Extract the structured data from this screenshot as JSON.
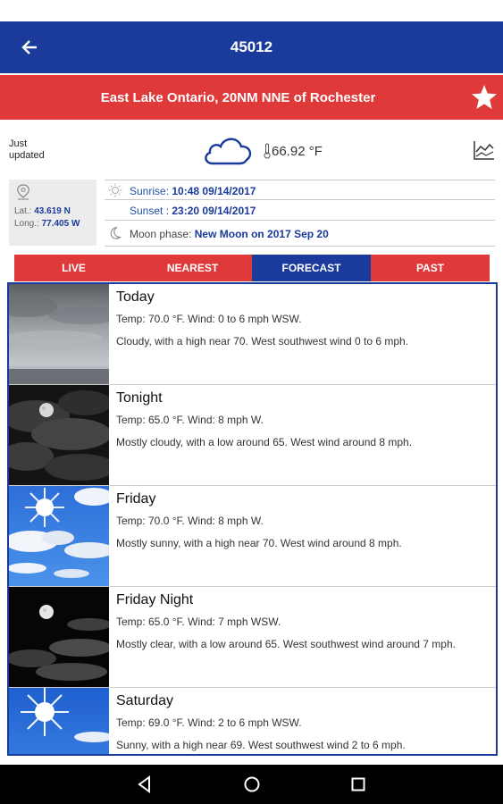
{
  "app_bar": {
    "title": "45012"
  },
  "location": {
    "title": "East Lake Ontario, 20NM NNE of Rochester"
  },
  "conditions": {
    "updated_line1": "Just",
    "updated_line2": "updated",
    "temperature": "66.92 °F"
  },
  "coords": {
    "lat_label": "Lat.:",
    "lat_value": "43.619 N",
    "long_label": "Long.:",
    "long_value": "77.405 W"
  },
  "sun": {
    "sunrise_label": "Sunrise:",
    "sunrise_value": "10:48 09/14/2017",
    "sunset_label": "Sunset :",
    "sunset_value": "23:20 09/14/2017",
    "moon_label": "Moon phase:",
    "moon_value": "New Moon on 2017 Sep 20"
  },
  "tabs": [
    {
      "label": "LIVE"
    },
    {
      "label": "NEAREST"
    },
    {
      "label": "FORECAST"
    },
    {
      "label": "PAST"
    }
  ],
  "active_tab": "FORECAST",
  "forecast": [
    {
      "name": "Today",
      "temp": "Temp: 70.0 °F. Wind: 0 to 6 mph WSW.",
      "desc": "Cloudy, with a high near 70. West southwest wind 0 to 6 mph.",
      "icon": "overcast-photo"
    },
    {
      "name": "Tonight",
      "temp": "Temp: 65.0 °F. Wind: 8 mph W.",
      "desc": "Mostly cloudy, with a low around 65. West wind around 8 mph.",
      "icon": "cloudy-night-photo"
    },
    {
      "name": "Friday",
      "temp": "Temp: 70.0 °F. Wind: 8 mph W.",
      "desc": "Mostly sunny, with a high near 70. West wind around 8 mph.",
      "icon": "mostly-sunny-photo"
    },
    {
      "name": "Friday Night",
      "temp": "Temp: 65.0 °F. Wind: 7 mph WSW.",
      "desc": "Mostly clear, with a low around 65. West southwest wind around 7 mph.",
      "icon": "clear-night-photo"
    },
    {
      "name": "Saturday",
      "temp": "Temp: 69.0 °F. Wind: 2 to 6 mph WSW.",
      "desc": "Sunny, with a high near 69. West southwest wind 2 to 6 mph.",
      "icon": "sunny-photo"
    }
  ],
  "colors": {
    "primary": "#1a3a9c",
    "accent": "#e0393a"
  }
}
